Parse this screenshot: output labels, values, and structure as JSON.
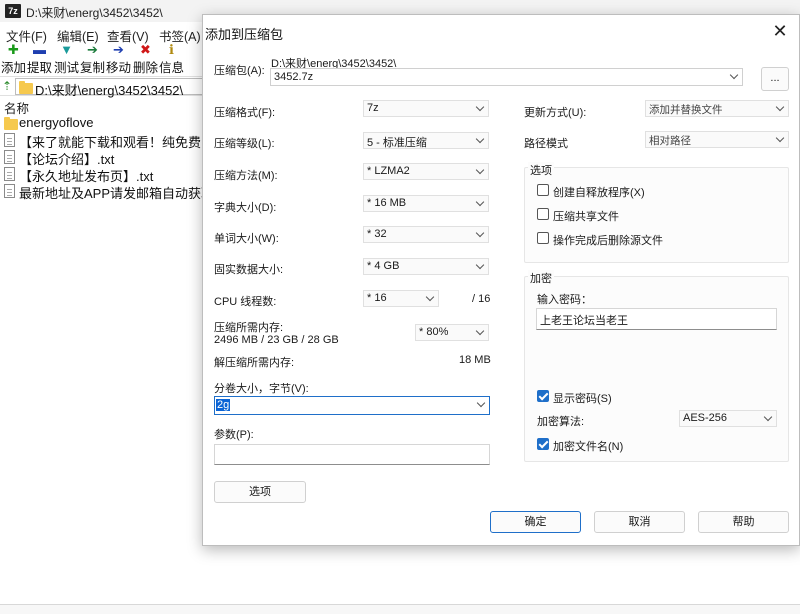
{
  "file_manager": {
    "app_icon": "7z",
    "title": "D:\\来财\\energ\\3452\\3452\\",
    "menu": [
      "文件(F)",
      "编辑(E)",
      "查看(V)",
      "书签(A)"
    ],
    "toolbar": [
      {
        "icon": "plus-icon",
        "label": "添加",
        "color": "#1a9a1a"
      },
      {
        "icon": "minus-icon",
        "label": "提取",
        "color": "#1f3fb0"
      },
      {
        "icon": "check-icon",
        "label": "测试",
        "color": "#1a9a9a"
      },
      {
        "icon": "arrow-right-icon",
        "label": "复制",
        "color": "#1a7a3a"
      },
      {
        "icon": "arrow-right-icon",
        "label": "移动",
        "color": "#1f3fb0"
      },
      {
        "icon": "x-icon",
        "label": "删除",
        "color": "#d01818"
      },
      {
        "icon": "info-icon",
        "label": "信息",
        "color": "#b08a10"
      }
    ],
    "address": "D:\\来财\\energ\\3452\\3452\\",
    "column_header": "名称",
    "rows": [
      {
        "type": "folder",
        "name": "energyoflove"
      },
      {
        "type": "file",
        "name": "【来了就能下载和观看！纯免费！】"
      },
      {
        "type": "file",
        "name": "【论坛介绍】.txt"
      },
      {
        "type": "file",
        "name": "【永久地址发布页】.txt"
      },
      {
        "type": "file",
        "name": "最新地址及APP请发邮箱自动获取!"
      }
    ]
  },
  "dialog": {
    "title": "添加到压缩包",
    "archive_label": "压缩包(A):",
    "archive_path": "D:\\来财\\energ\\3452\\3452\\",
    "archive_name": "3452.7z",
    "browse_label": "...",
    "left": {
      "format_label": "压缩格式(F):",
      "format_value": "7z",
      "level_label": "压缩等级(L):",
      "level_value": "5 - 标准压缩",
      "method_label": "压缩方法(M):",
      "method_value": "*  LZMA2",
      "dict_label": "字典大小(D):",
      "dict_value": "*  16 MB",
      "word_label": "单词大小(W):",
      "word_value": "*  32",
      "solid_label": "固实数据大小:",
      "solid_value": "*  4 GB",
      "cpu_label": "CPU 线程数:",
      "cpu_value": "*  16",
      "cpu_total": "/ 16",
      "mem_label": "压缩所需内存:",
      "mem_value": "2496 MB / 23 GB / 28 GB",
      "mem_percent": "* 80%",
      "decomp_label": "解压缩所需内存:",
      "decomp_value": "18 MB",
      "split_label": "分卷大小，字节(V):",
      "split_value": "2g",
      "params_label": "参数(P):",
      "params_value": "",
      "options_button": "选项"
    },
    "right": {
      "update_label": "更新方式(U):",
      "update_value": "添加并替换文件",
      "path_label": "路径模式",
      "path_value": "相对路径",
      "options_group": "选项",
      "sfx_label": "创建自释放程序(X)",
      "sfx_checked": false,
      "shared_label": "压缩共享文件",
      "shared_checked": false,
      "delete_label": "操作完成后删除源文件",
      "delete_checked": false,
      "encrypt_group": "加密",
      "password_label": "输入密码：",
      "password_value": "上老王论坛当老王",
      "show_password_label": "显示密码(S)",
      "show_password_checked": true,
      "enc_method_label": "加密算法:",
      "enc_method_value": "AES-256",
      "enc_names_label": "加密文件名(N)",
      "enc_names_checked": true
    },
    "buttons": {
      "ok": "确定",
      "cancel": "取消",
      "help": "帮助"
    }
  }
}
